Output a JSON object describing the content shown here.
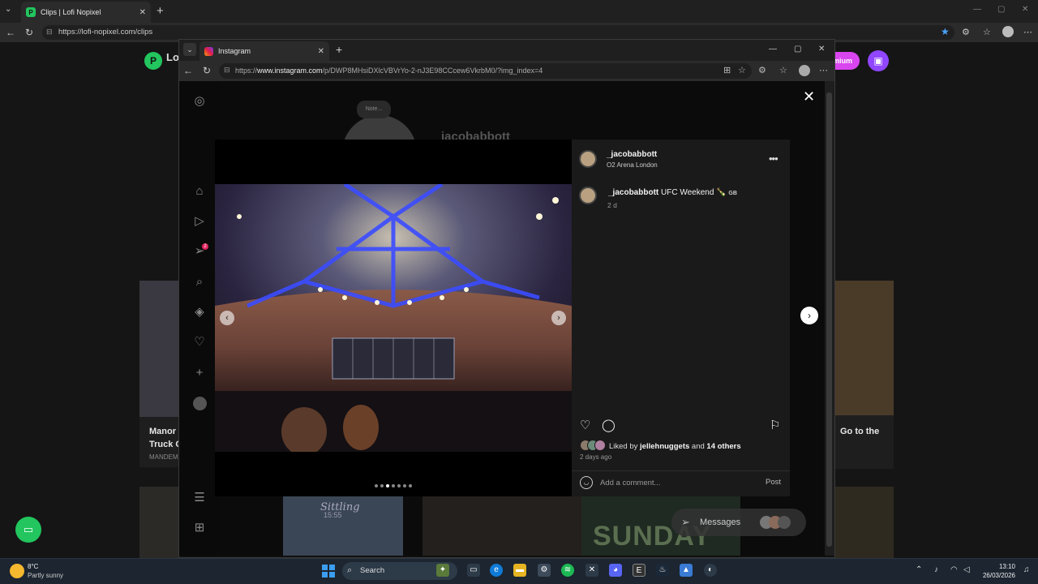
{
  "outer_browser": {
    "tab_title": "Clips | Lofi Nopixel",
    "url": "https://lofi-nopixel.com/clips",
    "new_tab": "+",
    "close_tab": "✕"
  },
  "background_page": {
    "logo_text": "Lo",
    "premium_label": "emium",
    "left_card_title_1": "Manor",
    "left_card_title_2": "Truck C",
    "left_card_meta": "MANDEM",
    "right_card_title": "Go to the"
  },
  "inner_browser": {
    "tab_title": "Instagram",
    "url_prefix": "https://",
    "url_host": "www.instagram.com",
    "url_path": "/p/DWP8MHsiDXlcVBVrYo-2-nJ3E98CCcew6VkrbM0/?img_index=4"
  },
  "instagram": {
    "profile_name": "jacobabbott",
    "profile_note": "Note...",
    "post": {
      "username": "_jacobabbott",
      "location": "O2 Arena London",
      "caption_user": "_jacobabbott",
      "caption_text": "UFC Weekend 🍾",
      "caption_flag": "GB",
      "caption_age": "2 d",
      "liked_by_prefix": "Liked by",
      "liked_by_user": "jellehnuggets",
      "liked_by_joiner": "and",
      "liked_by_others": "14 others",
      "date": "2 days ago",
      "comment_placeholder": "Add a comment...",
      "post_button": "Post",
      "carousel_count": 7,
      "carousel_active": 3
    },
    "grid_text_1": "Sittling",
    "grid_text_1b": "15:55",
    "grid_text_3": "SUNDAY",
    "messages_label": "Messages",
    "sidebar_badge": "2"
  },
  "taskbar": {
    "weather_temp": "8°C",
    "weather_desc": "Partly sunny",
    "search_label": "Search",
    "time": "13:10",
    "date": "26/03/2026"
  },
  "colors": {
    "accent_green": "#22c55e",
    "twitch_purple": "#9146ff",
    "premium_pink": "#d946ef"
  }
}
